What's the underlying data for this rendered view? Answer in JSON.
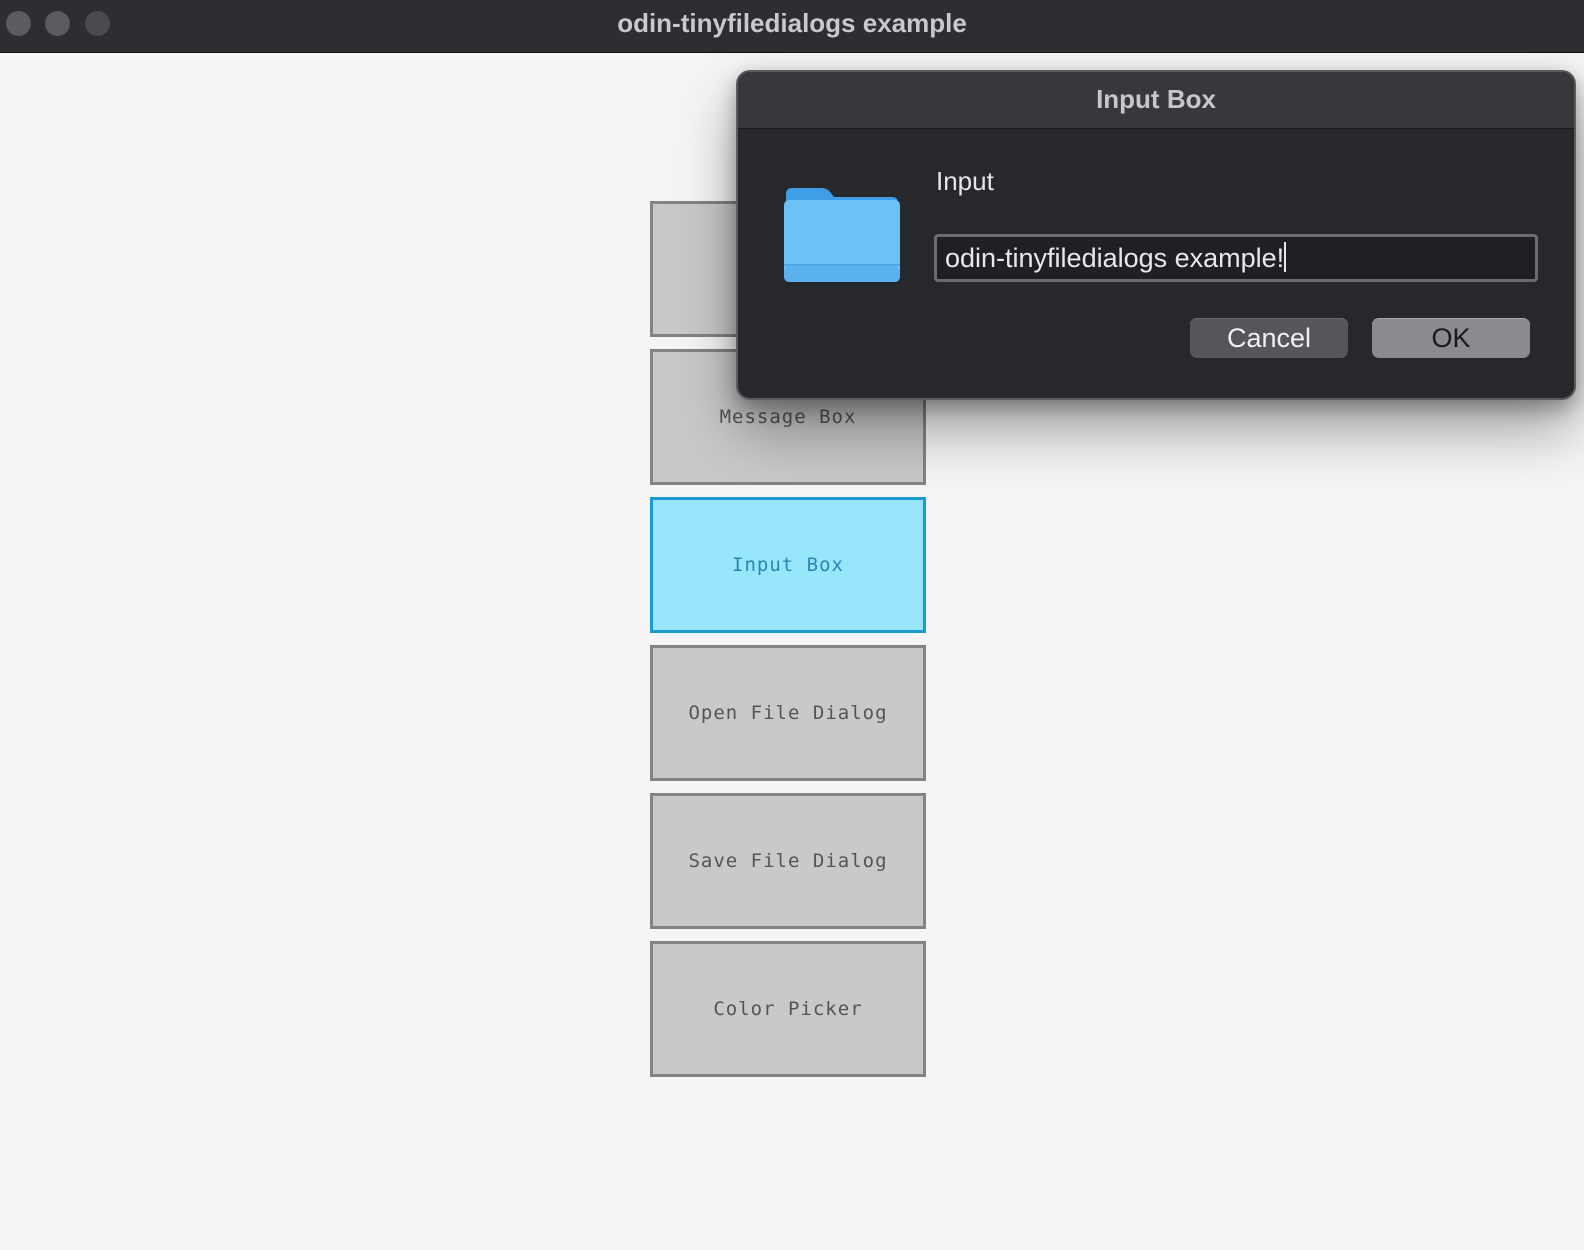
{
  "window": {
    "title": "odin-tinyfiledialogs example"
  },
  "app_buttons": [
    {
      "label": ""
    },
    {
      "label": "Message Box"
    },
    {
      "label": "Input Box"
    },
    {
      "label": "Open File Dialog"
    },
    {
      "label": "Save File Dialog"
    },
    {
      "label": "Color Picker"
    }
  ],
  "dialog": {
    "title": "Input Box",
    "icon": "folder-icon",
    "prompt": "Input",
    "input_value": "odin-tinyfiledialogs example!",
    "cancel_label": "Cancel",
    "ok_label": "OK"
  },
  "colors": {
    "active_button_bg": "#98e6fb",
    "active_button_border": "#1a9ad0",
    "button_bg": "#c9c9c9",
    "dialog_bg": "#27282c"
  }
}
